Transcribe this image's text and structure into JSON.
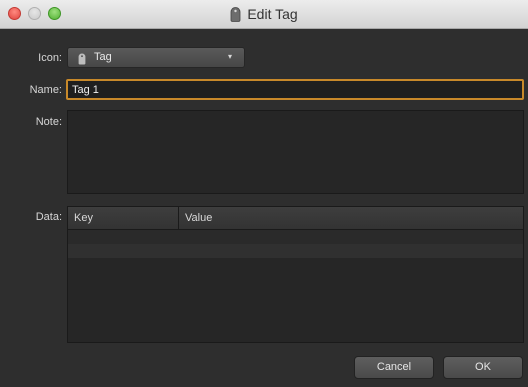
{
  "window": {
    "title": "Edit Tag"
  },
  "form": {
    "icon_label": "Icon:",
    "icon_value": "Tag",
    "name_label": "Name:",
    "name_value": "Tag 1",
    "note_label": "Note:",
    "note_value": "",
    "data_label": "Data:"
  },
  "data_table": {
    "columns": [
      "Key",
      "Value"
    ],
    "rows": []
  },
  "buttons": {
    "cancel": "Cancel",
    "ok": "OK"
  },
  "colors": {
    "focus_ring": "#c8892a",
    "background": "#2e2e2e"
  },
  "icons": {
    "title": "tag-icon",
    "popup": "tag-icon",
    "popup_arrow": "chevron-down-icon"
  }
}
